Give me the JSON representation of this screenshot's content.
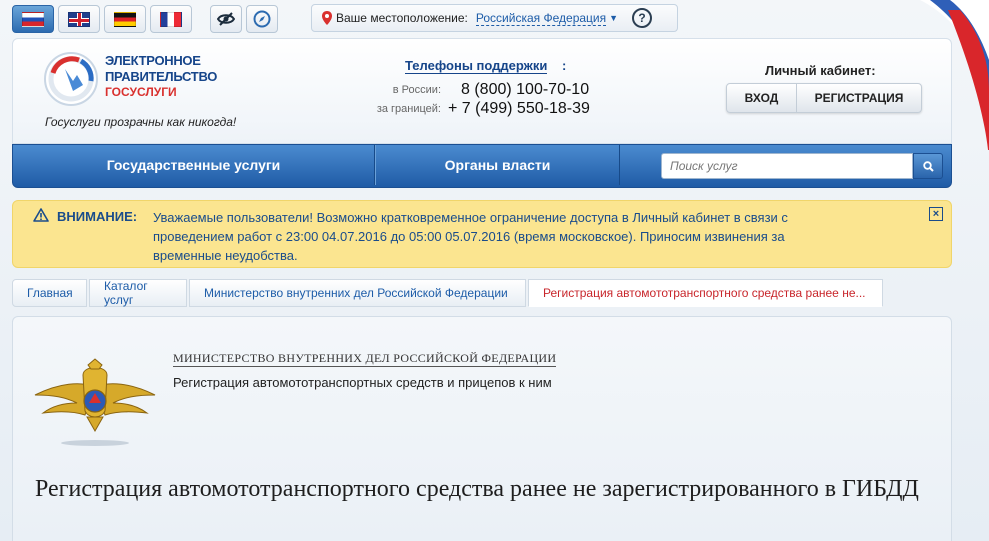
{
  "languages": [
    {
      "code": "ru",
      "active": true
    },
    {
      "code": "gb",
      "active": false
    },
    {
      "code": "de",
      "active": false
    },
    {
      "code": "fr",
      "active": false
    }
  ],
  "tools": {
    "accessibility_icon": "eye-icon",
    "sitemap_icon": "compass-icon"
  },
  "location": {
    "label": "Ваше местоположение:",
    "value": "Российская Федерация",
    "help": "?"
  },
  "header": {
    "logo_line1": "ЭЛЕКТРОННОЕ",
    "logo_line2": "ПРАВИТЕЛЬСТВО",
    "logo_line3": "ГОСУСЛУГИ",
    "slogan": "Госуслуги прозрачны как никогда!",
    "phones_title": "Телефоны поддержки",
    "phones_colon": ":",
    "phone_ru_label": "в России:",
    "phone_ru": "8 (800) 100-70-10",
    "phone_abroad_label": "за границей:",
    "phone_abroad": "+ 7 (499) 550-18-39",
    "cabinet_title": "Личный кабинет:",
    "login": "ВХОД",
    "register": "РЕГИСТРАЦИЯ"
  },
  "nav": {
    "services": "Государственные услуги",
    "authorities": "Органы власти",
    "search_placeholder": "Поиск услуг"
  },
  "notice": {
    "title": "ВНИМАНИЕ:",
    "text": "Уважаемые пользователи! Возможно кратковременное ограничение доступа в Личный кабинет в связи с проведением работ с 23:00 04.07.2016 до 05:00 05.07.2016 (время московское). Приносим извинения за временные неудобства.",
    "close": "×"
  },
  "breadcrumb": {
    "home": "Главная",
    "catalog": "Каталог услуг",
    "ministry": "Министерство внутренних дел Российской Федерации",
    "current": "Регистрация автомототранспортного средства ранее не..."
  },
  "content": {
    "ministry": "МИНИСТЕРСТВО ВНУТРЕННИХ ДЕЛ РОССИЙСКОЙ ФЕДЕРАЦИИ",
    "subtitle": "Регистрация автомототранспортных средств и прицепов к ним",
    "title": "Регистрация автомототранспортного средства ранее не зарегистрированного в ГИБДД"
  },
  "colors": {
    "brand_blue": "#1f5ba6",
    "notice_bg": "#fbe590",
    "link": "#1d5ca8",
    "active_crumb": "#c8262b"
  }
}
